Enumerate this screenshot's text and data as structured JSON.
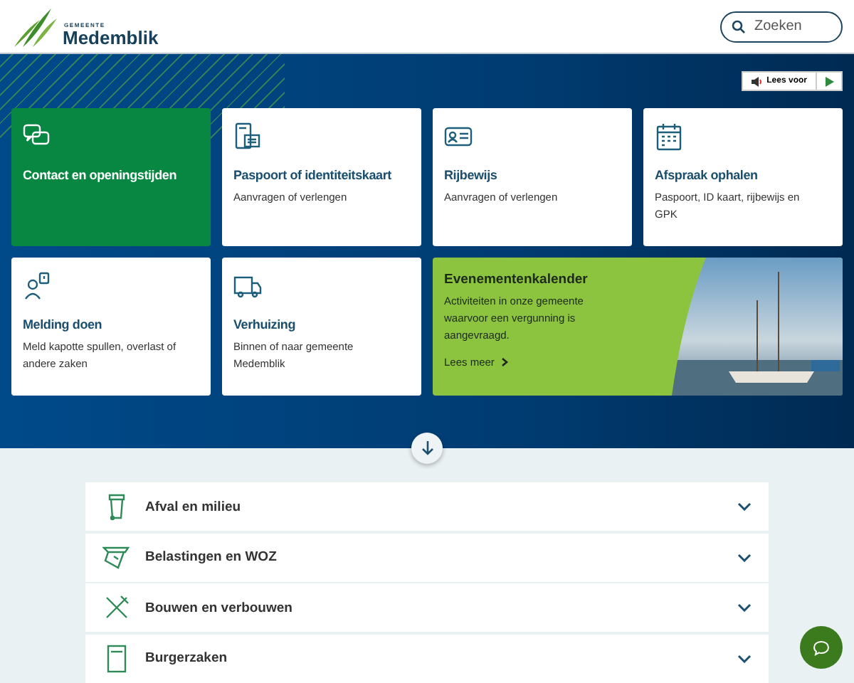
{
  "header": {
    "logo_small": "GEMEENTE",
    "logo_name": "Medemblik",
    "search": {
      "placeholder": "Zoeken"
    }
  },
  "hero": {
    "read_aloud": {
      "label": "Lees voor"
    },
    "cards": [
      {
        "kind": "highlight",
        "title": "Contact en openingstijden"
      },
      {
        "kind": "link",
        "title": "Paspoort of identiteitskaart",
        "text": "Aanvragen of verlengen"
      },
      {
        "kind": "link",
        "title": "Rijbewijs",
        "text": "Aanvragen of verlengen"
      },
      {
        "kind": "link",
        "title": "Afspraak ophalen",
        "text": "Paspoort, ID kaart, rijbewijs en GPK"
      },
      {
        "kind": "link",
        "title": "Melding doen",
        "text": "Meld kapotte spullen, overlast of andere zaken"
      },
      {
        "kind": "link",
        "title": "Verhuizing",
        "text": "Binnen of naar gemeente Medemblik"
      },
      {
        "kind": "feature",
        "title": "Evenementenkalender",
        "text": "Activiteiten in onze gemeente waarvoor een vergunning is aangevraagd.",
        "link": "Lees meer"
      }
    ]
  },
  "topics": [
    {
      "label": "Afval en milieu",
      "expanded": false
    },
    {
      "label": "Belastingen en WOZ",
      "expanded": false
    },
    {
      "label": "Bouwen en verbouwen",
      "expanded": false
    },
    {
      "label": "Burgerzaken",
      "expanded": false
    }
  ]
}
